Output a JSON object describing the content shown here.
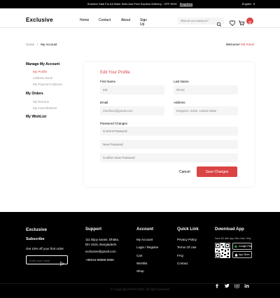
{
  "topbar": {
    "promo": "Summer Sale For All Swim Suits And Free Express Delivery - OFF 50%!",
    "shop_now": "ShopNow",
    "language": "English"
  },
  "header": {
    "logo": "Exclusive",
    "nav": [
      "Home",
      "Contact",
      "About",
      "Sign Up"
    ],
    "search_placeholder": "What are you looking for?"
  },
  "breadcrumb": {
    "home": "Home",
    "separator": "/",
    "current": "My Account",
    "welcome_prefix": "Welcome!",
    "welcome_name": "Md Rimel"
  },
  "sidebar": {
    "manage_title": "Manage My Account",
    "manage_items": [
      "My Profile",
      "Address Book",
      "My Payment Options"
    ],
    "orders_title": "My Orders",
    "orders_items": [
      "My Returns",
      "My Cancellations"
    ],
    "wishlist_title": "My WishList"
  },
  "form": {
    "title": "Edit Your Profile",
    "first_name_label": "First Name",
    "first_name_value": "Md",
    "last_name_label": "Last Name",
    "last_name_value": "Rimel",
    "email_label": "Email",
    "email_value": "rimell111@gmail.com",
    "address_label": "Address",
    "address_value": "Kingston, 5236, United State",
    "password_label": "Password Changes",
    "current_password_placeholder": "Current Passwod",
    "new_password_placeholder": "New Passwod",
    "confirm_password_placeholder": "Confirm New Passwod",
    "cancel_label": "Cancel",
    "save_label": "Save Changes"
  },
  "footer": {
    "brand": "Exclusive",
    "subscribe_title": "Subscribe",
    "subscribe_text": "Get 10% off your first order",
    "email_placeholder": "Enter your email",
    "support_title": "Support",
    "support_address_1": "111 Bijoy sarani, Dhaka,",
    "support_address_2": "DH 1515, Bangladesh.",
    "support_email": "exclusive@gmail.com",
    "support_phone": "+88015-88888-9999",
    "account_title": "Account",
    "account_links": [
      "My Account",
      "Login / Register",
      "Cart",
      "Wishlist",
      "Shop"
    ],
    "quick_title": "Quick Link",
    "quick_links": [
      "Privacy Policy",
      "Terms Of Use",
      "FAQ",
      "Contact"
    ],
    "app_title": "Download App",
    "app_text": "Save $3 with App New User Only",
    "google_play": "Google Play",
    "app_store": "App Store",
    "copyright": "Copyright Rimel 2022. All right reserved"
  },
  "colors": {
    "accent": "#db4444",
    "footer_bg": "#000000",
    "field_bg": "#f5f5f5"
  }
}
